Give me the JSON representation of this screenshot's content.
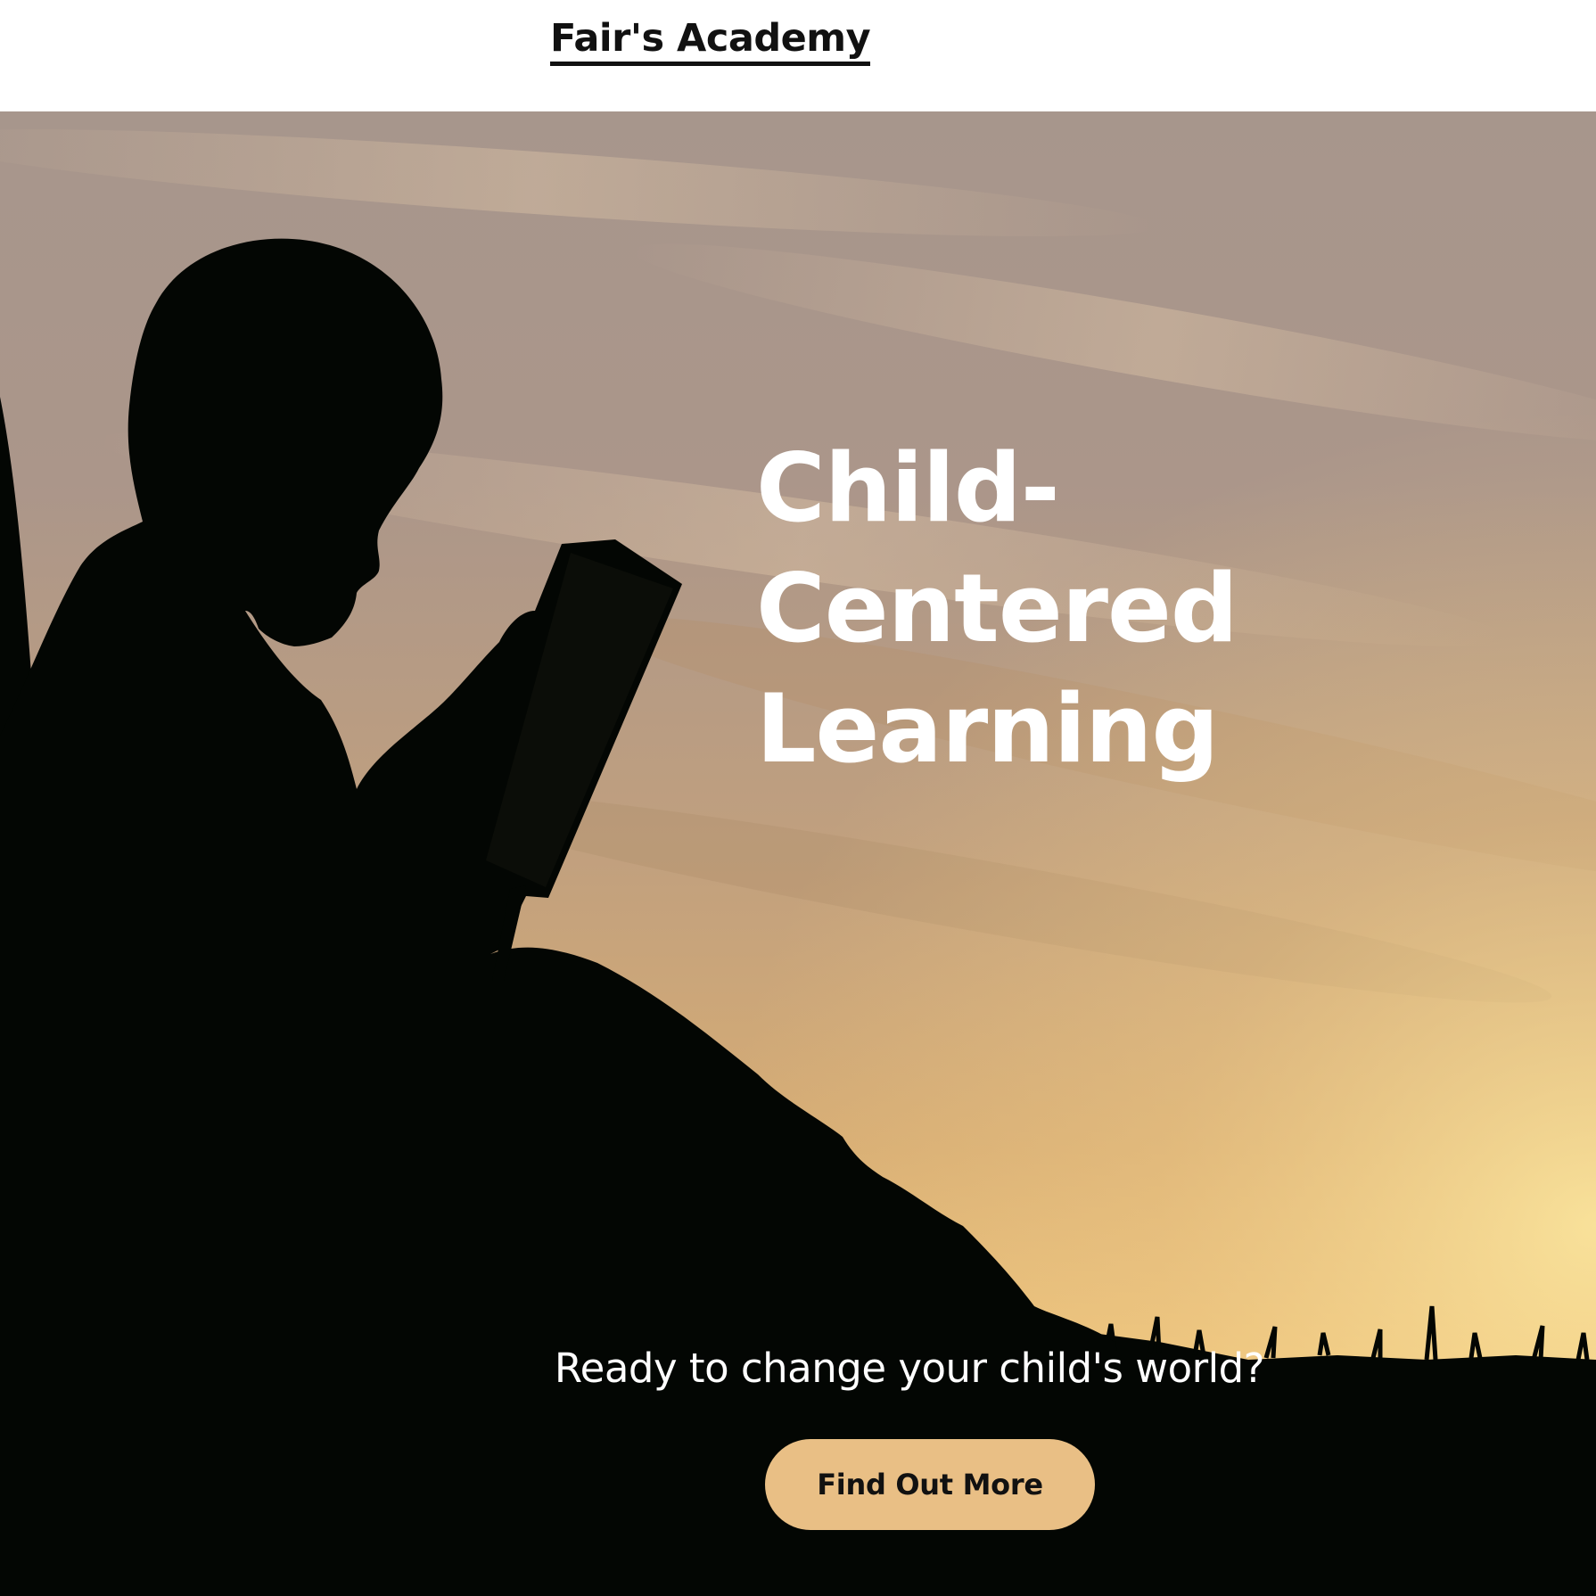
{
  "header": {
    "brand": "Fair's Academy"
  },
  "hero": {
    "background": "silhouette-of-child-reading-book-at-sunset",
    "headline_lines": [
      "Child-",
      "Centered",
      "Learning"
    ],
    "tagline": "Ready to change your child's world?",
    "cta_label": "Find Out More"
  },
  "colors": {
    "header_bg": "#ffffff",
    "cta_bg": "#e9bf85",
    "headline_text": "#ffffff",
    "silhouette": "#030603"
  }
}
